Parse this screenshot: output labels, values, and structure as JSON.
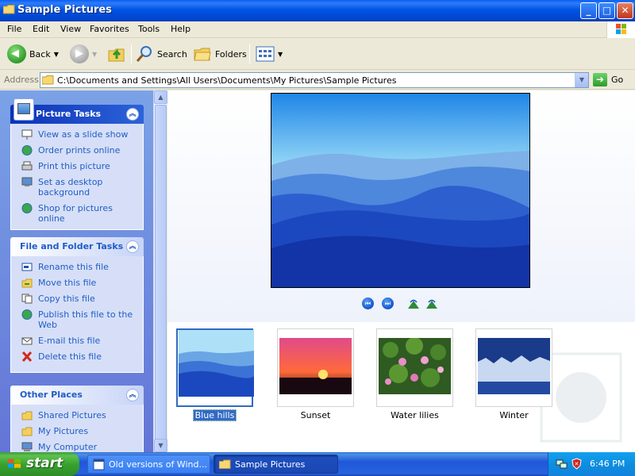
{
  "window": {
    "title": "Sample Pictures",
    "controls": {
      "minimize": "_",
      "maximize": "□",
      "close": "✕"
    }
  },
  "menu": {
    "items": [
      "File",
      "Edit",
      "View",
      "Favorites",
      "Tools",
      "Help"
    ]
  },
  "toolbar": {
    "back_label": "Back",
    "search_label": "Search",
    "folders_label": "Folders"
  },
  "address": {
    "label": "Address",
    "path": "C:\\Documents and Settings\\All Users\\Documents\\My Pictures\\Sample Pictures",
    "go_label": "Go"
  },
  "taskpane": {
    "picture_tasks": {
      "title": "Picture Tasks",
      "items": [
        {
          "label": "View as a slide show",
          "icon": "slideshow-icon"
        },
        {
          "label": "Order prints online",
          "icon": "globe-icon"
        },
        {
          "label": "Print this picture",
          "icon": "printer-icon"
        },
        {
          "label": "Set as desktop background",
          "icon": "desktop-icon"
        },
        {
          "label": "Shop for pictures online",
          "icon": "globe-icon"
        }
      ]
    },
    "file_folder_tasks": {
      "title": "File and Folder Tasks",
      "items": [
        {
          "label": "Rename this file",
          "icon": "rename-icon"
        },
        {
          "label": "Move this file",
          "icon": "move-icon"
        },
        {
          "label": "Copy this file",
          "icon": "copy-icon"
        },
        {
          "label": "Publish this file to the Web",
          "icon": "publish-icon"
        },
        {
          "label": "E-mail this file",
          "icon": "email-icon"
        },
        {
          "label": "Delete this file",
          "icon": "delete-icon"
        }
      ]
    },
    "other_places": {
      "title": "Other Places",
      "items": [
        {
          "label": "Shared Pictures",
          "icon": "folder-icon"
        },
        {
          "label": "My Pictures",
          "icon": "folder-icon"
        },
        {
          "label": "My Computer",
          "icon": "computer-icon"
        }
      ]
    }
  },
  "thumbnails": [
    {
      "label": "Blue hills",
      "selected": true
    },
    {
      "label": "Sunset",
      "selected": false
    },
    {
      "label": "Water lilies",
      "selected": false
    },
    {
      "label": "Winter",
      "selected": false
    }
  ],
  "taskbar": {
    "start_label": "start",
    "tasks": [
      {
        "label": "Old versions of Wind...",
        "active": false
      },
      {
        "label": "Sample Pictures",
        "active": true
      }
    ],
    "clock": "6:46 PM"
  }
}
